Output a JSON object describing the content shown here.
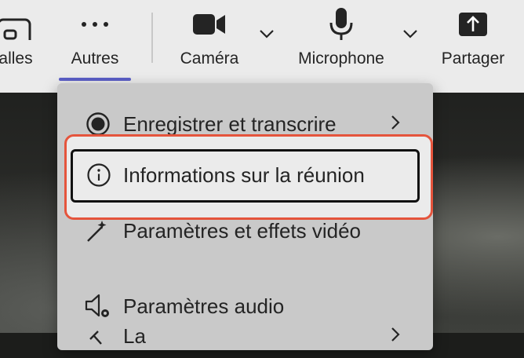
{
  "toolbar": {
    "items": [
      {
        "label": "alles",
        "icon": "rooms-icon"
      },
      {
        "label": "Autres",
        "icon": "more-icon"
      },
      {
        "label": "Caméra",
        "icon": "camera-icon"
      },
      {
        "label": "Microphone",
        "icon": "microphone-icon"
      },
      {
        "label": "Partager",
        "icon": "share-icon"
      }
    ],
    "active_color": "#5b5fc7"
  },
  "menu": {
    "items": [
      {
        "label": "Enregistrer et transcrire",
        "icon": "record-icon",
        "has_submenu": true
      },
      {
        "label": "Informations sur la réunion",
        "icon": "info-icon",
        "has_submenu": false,
        "focused": true
      },
      {
        "label": "Paramètres et effets vidéo",
        "icon": "magic-wand-icon",
        "has_submenu": false
      },
      {
        "label": "Paramètres audio",
        "icon": "speaker-settings-icon",
        "has_submenu": false
      },
      {
        "label": "La",
        "icon": "language-icon",
        "has_submenu": true
      }
    ]
  },
  "colors": {
    "highlight": "#e5543c",
    "toolbar_bg": "#ebebeb",
    "menu_bg": "#c9c9c9"
  }
}
